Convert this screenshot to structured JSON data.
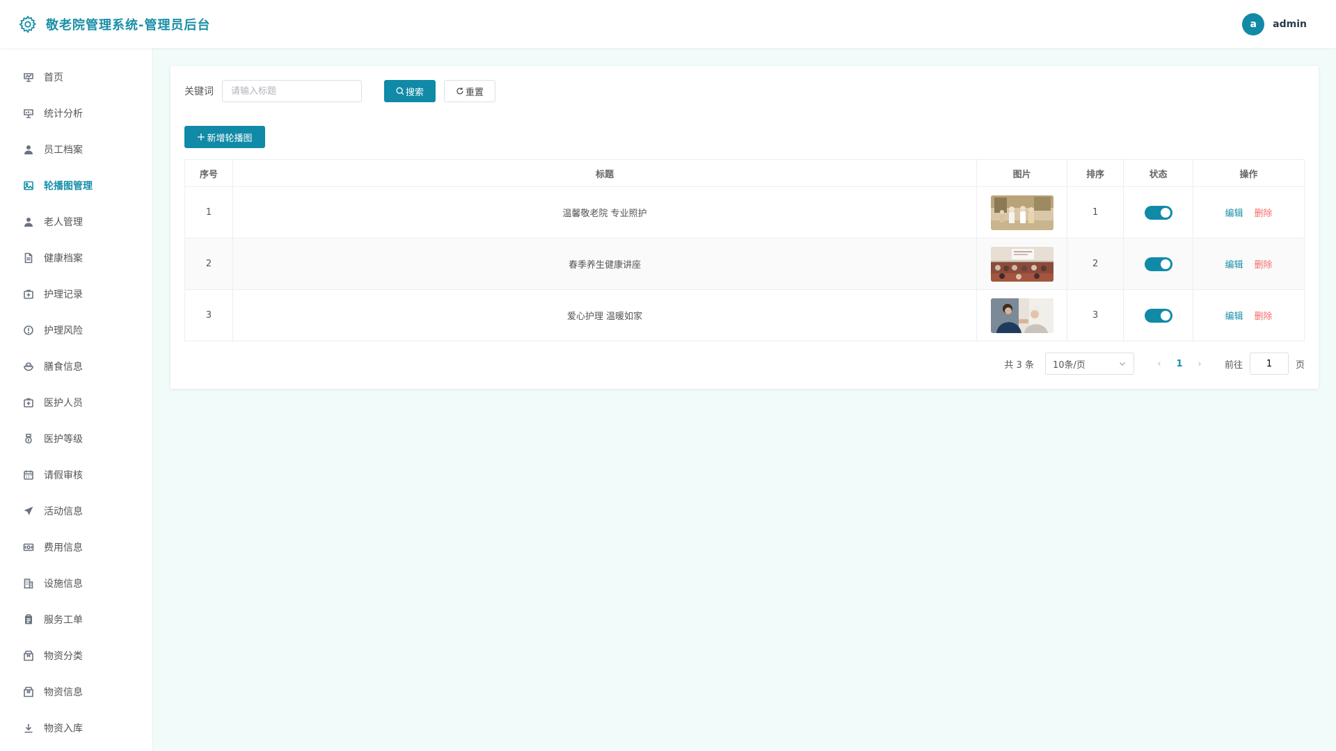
{
  "header": {
    "title": "敬老院管理系统-管理员后台",
    "user_initial": "a",
    "username": "admin",
    "brand_color": "#108aa6"
  },
  "sidebar": {
    "items": [
      {
        "label": "首页",
        "icon": "presentation-icon"
      },
      {
        "label": "统计分析",
        "icon": "chart-board-icon"
      },
      {
        "label": "员工档案",
        "icon": "user-icon"
      },
      {
        "label": "轮播图管理",
        "icon": "picture-icon",
        "active": true
      },
      {
        "label": "老人管理",
        "icon": "user-icon"
      },
      {
        "label": "健康档案",
        "icon": "document-icon"
      },
      {
        "label": "护理记录",
        "icon": "first-aid-icon"
      },
      {
        "label": "护理风险",
        "icon": "warning-icon"
      },
      {
        "label": "膳食信息",
        "icon": "bowl-icon"
      },
      {
        "label": "医护人员",
        "icon": "first-aid-icon"
      },
      {
        "label": "医护等级",
        "icon": "medal-icon"
      },
      {
        "label": "请假审核",
        "icon": "calendar-icon"
      },
      {
        "label": "活动信息",
        "icon": "send-icon"
      },
      {
        "label": "费用信息",
        "icon": "money-icon"
      },
      {
        "label": "设施信息",
        "icon": "building-icon"
      },
      {
        "label": "服务工单",
        "icon": "clipboard-icon"
      },
      {
        "label": "物资分类",
        "icon": "box-icon"
      },
      {
        "label": "物资信息",
        "icon": "box-icon"
      },
      {
        "label": "物资入库",
        "icon": "download-icon"
      }
    ]
  },
  "search": {
    "label": "关键词",
    "placeholder": "请输入标题",
    "value": "",
    "search_label": "搜索",
    "reset_label": "重置"
  },
  "toolbar": {
    "add_label": "新增轮播图"
  },
  "table": {
    "headers": [
      "序号",
      "标题",
      "图片",
      "排序",
      "状态",
      "操作"
    ],
    "edit_label": "编辑",
    "delete_label": "删除",
    "rows": [
      {
        "index": "1",
        "title": "温馨敬老院 专业照护",
        "sort": "1",
        "enabled": true
      },
      {
        "index": "2",
        "title": "春季养生健康讲座",
        "sort": "2",
        "enabled": true
      },
      {
        "index": "3",
        "title": "爱心护理 温暖如家",
        "sort": "3",
        "enabled": true
      }
    ]
  },
  "pagination": {
    "total": "共 3 条",
    "page_size": "10条/页",
    "current": "1",
    "jump_label": "前往",
    "jump_value": "1",
    "jump_suffix": "页"
  }
}
